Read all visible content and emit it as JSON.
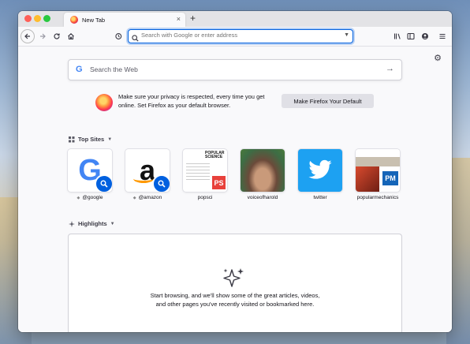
{
  "tab": {
    "title": "New Tab",
    "close": "×",
    "new_tab": "+"
  },
  "urlbar": {
    "placeholder": "Search with Google or enter address"
  },
  "websearch": {
    "placeholder": "Search the Web",
    "logo_letter": "G"
  },
  "promo": {
    "text": "Make sure your privacy is respected, every time you get online. Set Firefox as your default browser.",
    "button": "Make Firefox Your Default"
  },
  "top_sites": {
    "heading": "Top Sites",
    "sites": [
      {
        "label": "@google",
        "pinned": true
      },
      {
        "label": "@amazon",
        "pinned": true
      },
      {
        "label": "popsci",
        "pinned": false
      },
      {
        "label": "voiceofharold",
        "pinned": false
      },
      {
        "label": "twitter",
        "pinned": false
      },
      {
        "label": "popularmechanics",
        "pinned": false
      }
    ],
    "popsci_logo": "POPULAR SCIENCE",
    "popsci_badge": "PS",
    "pm_badge": "PM"
  },
  "highlights": {
    "heading": "Highlights",
    "empty_text": "Start browsing, and we'll show some of the great articles, videos, and other pages you've recently visited or bookmarked here."
  },
  "icons": [
    "back-icon",
    "forward-icon",
    "reload-icon",
    "home-icon",
    "history-icon",
    "search-icon",
    "library-icon",
    "sidebar-icon",
    "account-icon",
    "menu-icon",
    "gear-icon",
    "arrow-right-icon",
    "sparkle-icon"
  ]
}
